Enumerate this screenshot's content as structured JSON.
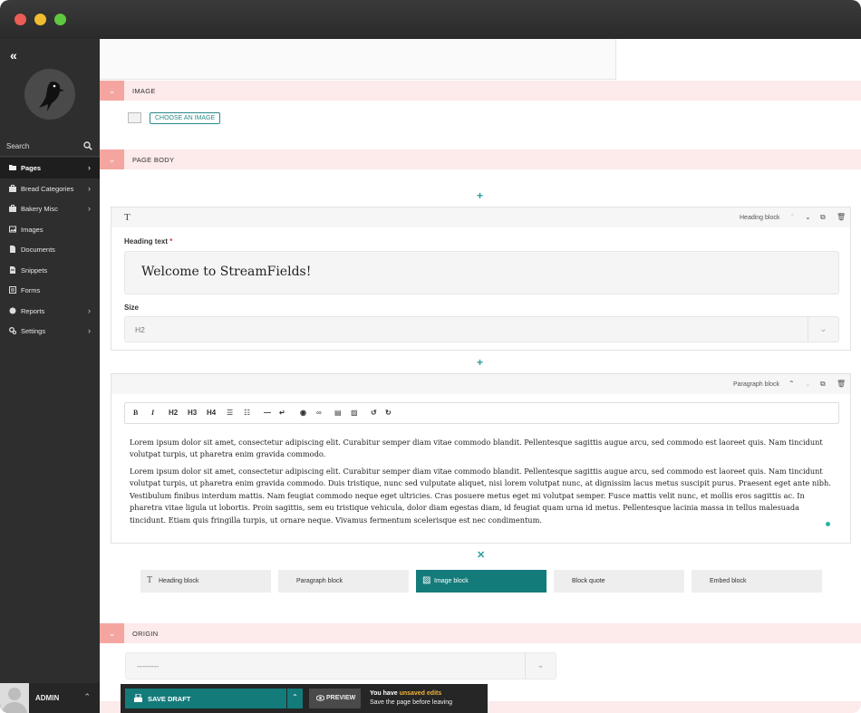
{
  "sidebar": {
    "search_label": "Search",
    "menu": [
      {
        "label": "Pages",
        "icon": "folder-icon",
        "chevron": true,
        "active": true
      },
      {
        "label": "Bread Categories",
        "icon": "suitcase-icon",
        "chevron": true
      },
      {
        "label": "Bakery Misc",
        "icon": "suitcase-icon",
        "chevron": true
      },
      {
        "label": "Images",
        "icon": "image-icon",
        "chevron": false
      },
      {
        "label": "Documents",
        "icon": "document-icon",
        "chevron": false
      },
      {
        "label": "Snippets",
        "icon": "snippet-icon",
        "chevron": false
      },
      {
        "label": "Forms",
        "icon": "form-icon",
        "chevron": false
      },
      {
        "label": "Reports",
        "icon": "globe-icon",
        "chevron": true
      },
      {
        "label": "Settings",
        "icon": "cogs-icon",
        "chevron": true
      }
    ],
    "account_name": "ADMIN"
  },
  "sections": {
    "image": "IMAGE",
    "choose_image": "CHOOSE AN IMAGE",
    "page_body": "PAGE BODY",
    "origin": "ORIGIN"
  },
  "heading_block": {
    "icon_text": "T",
    "type_label": "Heading block",
    "heading_label": "Heading text",
    "required_mark": "*",
    "heading_value": "Welcome to StreamFields!",
    "size_label": "Size",
    "size_value": "H2"
  },
  "paragraph_block": {
    "type_label": "Paragraph block",
    "toolbar": [
      "B",
      "I",
      "H2",
      "H3",
      "H4"
    ],
    "paragraph1": "Lorem ipsum dolor sit amet, consectetur adipiscing elit. Curabitur semper diam vitae commodo blandit. Pellentesque sagittis augue arcu, sed commodo est laoreet quis. Nam tincidunt volutpat turpis, ut pharetra enim gravida commodo.",
    "paragraph2": "Lorem ipsum dolor sit amet, consectetur adipiscing elit. Curabitur semper diam vitae commodo blandit. Pellentesque sagittis augue arcu, sed commodo est laoreet quis. Nam tincidunt volutpat turpis, ut pharetra enim gravida commodo. Duis tristique, nunc sed vulputate aliquet, nisi lorem volutpat nunc, at dignissim lacus metus suscipit purus. Praesent eget ante nibh. Vestibulum finibus interdum mattis. Nam feugiat commodo neque eget ultricies. Cras posuere metus eget mi volutpat semper. Fusce mattis velit nunc, et mollis eros sagittis ac. In pharetra vitae ligula ut lobortis. Proin sagittis, sem eu tristique vehicula, dolor diam egestas diam, id feugiat quam urna id metus. Pellentesque lacinia massa in tellus malesuada tincidunt. Etiam quis fringilla turpis, ut ornare neque. Vivamus fermentum scelerisque est nec condimentum."
  },
  "block_chooser": [
    {
      "label": "Heading block",
      "icon": "T",
      "selected": false
    },
    {
      "label": "Paragraph block",
      "icon": "",
      "selected": false
    },
    {
      "label": "Image block",
      "icon": "",
      "selected": true
    },
    {
      "label": "Block quote",
      "icon": "",
      "selected": false
    },
    {
      "label": "Embed block",
      "icon": "",
      "selected": false
    }
  ],
  "origin_value": "---------",
  "footer": {
    "save_label": "SAVE DRAFT",
    "preview_label": "PREVIEW",
    "unsaved_prefix": "You have",
    "unsaved_highlight": "unsaved edits",
    "unsaved_sub": "Save the page before leaving"
  },
  "colors": {
    "accent": "#147b7b",
    "section_bg": "#fdeaea",
    "section_toggle": "#f5a5a0"
  }
}
